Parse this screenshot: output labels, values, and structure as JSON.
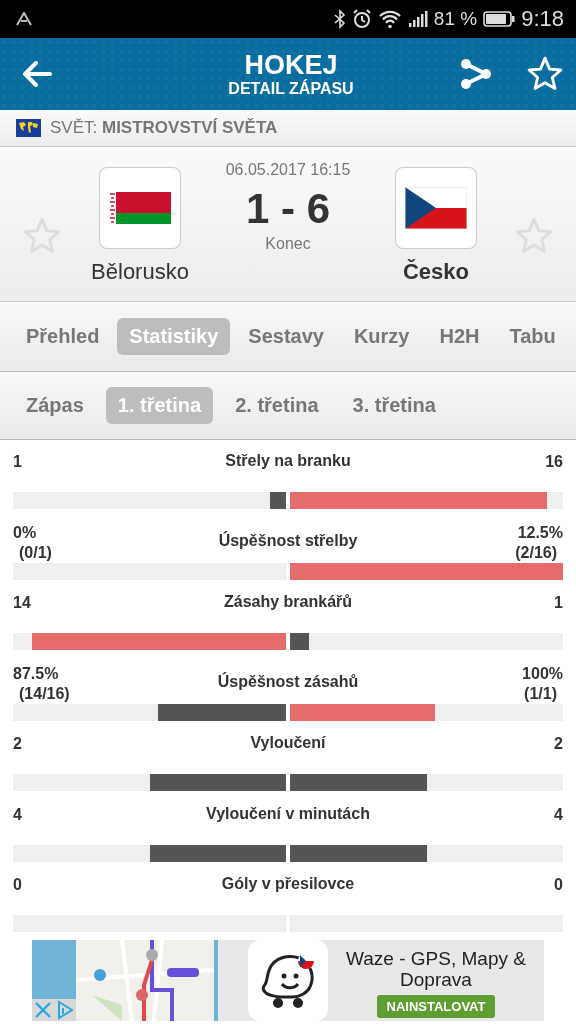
{
  "status_bar": {
    "battery": "81 %",
    "time": "9:18"
  },
  "header": {
    "title": "HOKEJ",
    "subtitle": "DETAIL ZÁPASU"
  },
  "competition": {
    "region": "SVĚT:",
    "name": "MISTROVSTVÍ SVĚTA"
  },
  "match": {
    "datetime": "06.05.2017 16:15",
    "score": "1 - 6",
    "status": "Konec",
    "home": {
      "name": "Bělorusko",
      "winner": false,
      "favorite": false
    },
    "away": {
      "name": "Česko",
      "winner": true,
      "favorite": false
    }
  },
  "tabs": [
    {
      "label": "Přehled",
      "selected": false
    },
    {
      "label": "Statistiky",
      "selected": true
    },
    {
      "label": "Sestavy",
      "selected": false
    },
    {
      "label": "Kurzy",
      "selected": false
    },
    {
      "label": "H2H",
      "selected": false
    },
    {
      "label": "Tabu",
      "selected": false
    }
  ],
  "period_tabs": [
    {
      "label": "Zápas",
      "selected": false
    },
    {
      "label": "1. třetina",
      "selected": true
    },
    {
      "label": "2. třetina",
      "selected": false
    },
    {
      "label": "3. třetina",
      "selected": false
    }
  ],
  "stats": [
    {
      "name": "Střely na branku",
      "home": {
        "value": "1",
        "level": 0.06
      },
      "away": {
        "value": "16",
        "level": 0.94
      }
    },
    {
      "name": "Úspěšnost střelby",
      "home": {
        "value": "0%",
        "detail": "(0/1)",
        "level": 0
      },
      "away": {
        "value": "12.5%",
        "detail": "(2/16)",
        "level": 1
      }
    },
    {
      "name": "Zásahy brankářů",
      "home": {
        "value": "14",
        "level": 0.93
      },
      "away": {
        "value": "1",
        "level": 0.07
      }
    },
    {
      "name": "Úspěšnost zásahů",
      "home": {
        "value": "87.5%",
        "detail": "(14/16)",
        "level": 0.47
      },
      "away": {
        "value": "100%",
        "detail": "(1/1)",
        "level": 0.53
      }
    },
    {
      "name": "Vyloučení",
      "home": {
        "value": "2",
        "level": 0.5
      },
      "away": {
        "value": "2",
        "level": 0.5
      }
    },
    {
      "name": "Vyloučení v minutách",
      "home": {
        "value": "4",
        "level": 0.5
      },
      "away": {
        "value": "4",
        "level": 0.5
      }
    },
    {
      "name": "Góly v přesilovce",
      "home": {
        "value": "0",
        "level": 0
      },
      "away": {
        "value": "0",
        "level": 0
      }
    }
  ],
  "ad": {
    "kind": "picture",
    "title": "Waze - GPS, Mapy & Doprava",
    "button": "NAINSTALOVAT"
  }
}
